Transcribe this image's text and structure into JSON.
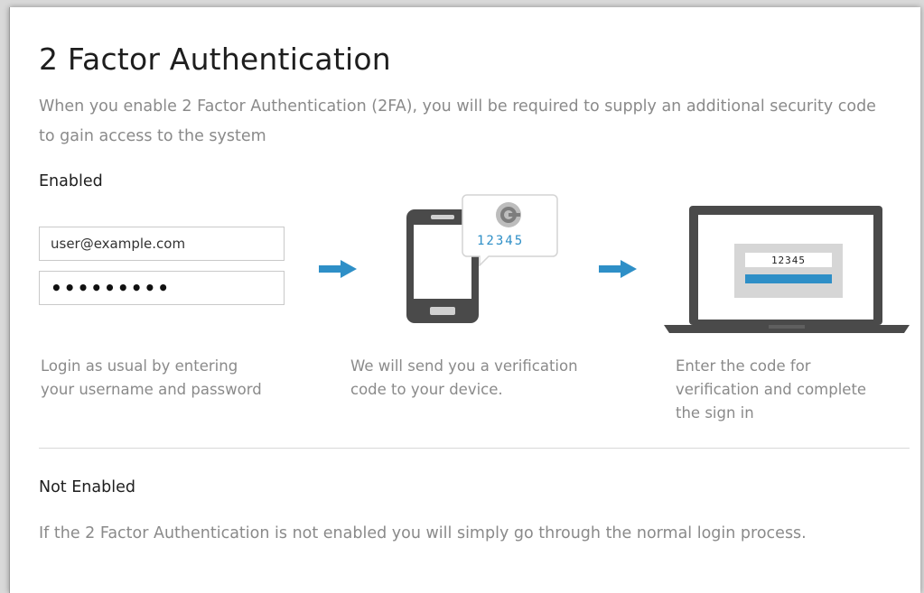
{
  "header": {
    "title": "2 Factor Authentication",
    "intro": "When you enable 2 Factor Authentication (2FA), you will be required to supply an additional security code to gain access to the system"
  },
  "enabled": {
    "label": "Enabled",
    "username_value": "user@example.com",
    "password_value": "•••••••••",
    "verification_code": "12345",
    "steps": [
      {
        "text": "Login as usual by entering your username and password"
      },
      {
        "text": "We will send you a verification code to your device."
      },
      {
        "text": "Enter the code for verification and complete the sign in"
      }
    ]
  },
  "not_enabled": {
    "label": "Not Enabled",
    "text": "If the 2 Factor Authentication is not enabled you will simply go through the normal login process."
  },
  "colors": {
    "accent": "#2e8fc7",
    "device": "#4a4a4a",
    "muted_text": "#8a8a8a"
  },
  "icons": [
    "arrow-right-icon",
    "smartphone-icon",
    "message-bubble-icon",
    "google-authenticator-icon",
    "laptop-icon"
  ]
}
